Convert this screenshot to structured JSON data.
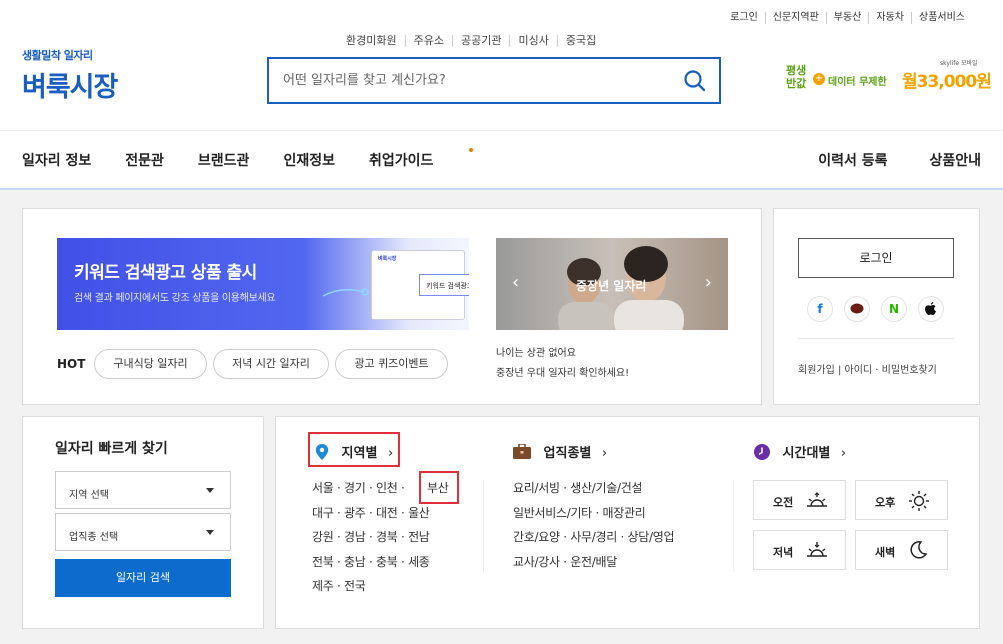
{
  "util_links": [
    "로그인",
    "신문지역판",
    "부동산",
    "자동차",
    "상품서비스"
  ],
  "logo": {
    "sub": "생활밀착 일자리",
    "main": "벼룩시장"
  },
  "keywords": [
    "환경미화원",
    "주유소",
    "공공기관",
    "미싱사",
    "중국집"
  ],
  "search": {
    "placeholder": "어떤 일자리를 찾고 계신가요?"
  },
  "ad": {
    "line1": "평생",
    "line2": "반값",
    "middle": "데이터 무제한",
    "price": "월33,000원",
    "brand": "skylife 모바일"
  },
  "gnb": {
    "items": [
      "일자리 정보",
      "전문관",
      "브랜드관",
      "인재정보",
      "취업가이드"
    ],
    "right": [
      "이력서 등록",
      "상품안내"
    ]
  },
  "promo": {
    "title": "키워드 검색광고 상품 출시",
    "subtitle": "검색 결과 페이지에서도 강조 상품을 이용해보세요",
    "card_label": "키워드 검색광고 상품",
    "card_logo": "벼룩시장"
  },
  "hot": {
    "label": "HOT",
    "tags": [
      "구내식당 일자리",
      "저녁 시간 일자리",
      "광고 퀴즈이벤트"
    ]
  },
  "photo_banner": {
    "title": "중장년 일자리",
    "caption1": "나이는 상관 없어요",
    "caption2": "중장년 우대 일자리 확인하세요!"
  },
  "login": {
    "button": "로그인",
    "sns": [
      "f",
      "💬",
      "N",
      ""
    ],
    "links": "회원가입 | 아이디 · 비밀번호찾기"
  },
  "quick_search": {
    "title": "일자리 빠르게 찾기",
    "region_select": "지역 선택",
    "job_select": "업직종 선택",
    "button": "일자리 검색"
  },
  "region": {
    "header": "지역별",
    "rows": [
      "서울 · 경기 · 인천 ·",
      "대구 · 광주 · 대전 · 울산",
      "강원 · 경남 · 경북 · 전남",
      "전북 · 충남 · 충북 · 세종",
      "제주 · 전국"
    ],
    "highlight": "부산"
  },
  "job": {
    "header": "업직종별",
    "rows": [
      "요리/서빙 · 생산/기술/건설",
      "일반서비스/기타 · 매장관리",
      "간호/요양 · 사무/경리 · 상담/영업",
      "교사/강사 · 운전/배달"
    ]
  },
  "time": {
    "header": "시간대별",
    "buttons": [
      "오전",
      "오후",
      "저녁",
      "새벽"
    ]
  },
  "colors": {
    "brand_blue": "#1a5fc0",
    "button_blue": "#0d6bcd",
    "highlight_red": "#e0313a",
    "ad_green": "#5ca314",
    "ad_orange": "#f2a300"
  }
}
